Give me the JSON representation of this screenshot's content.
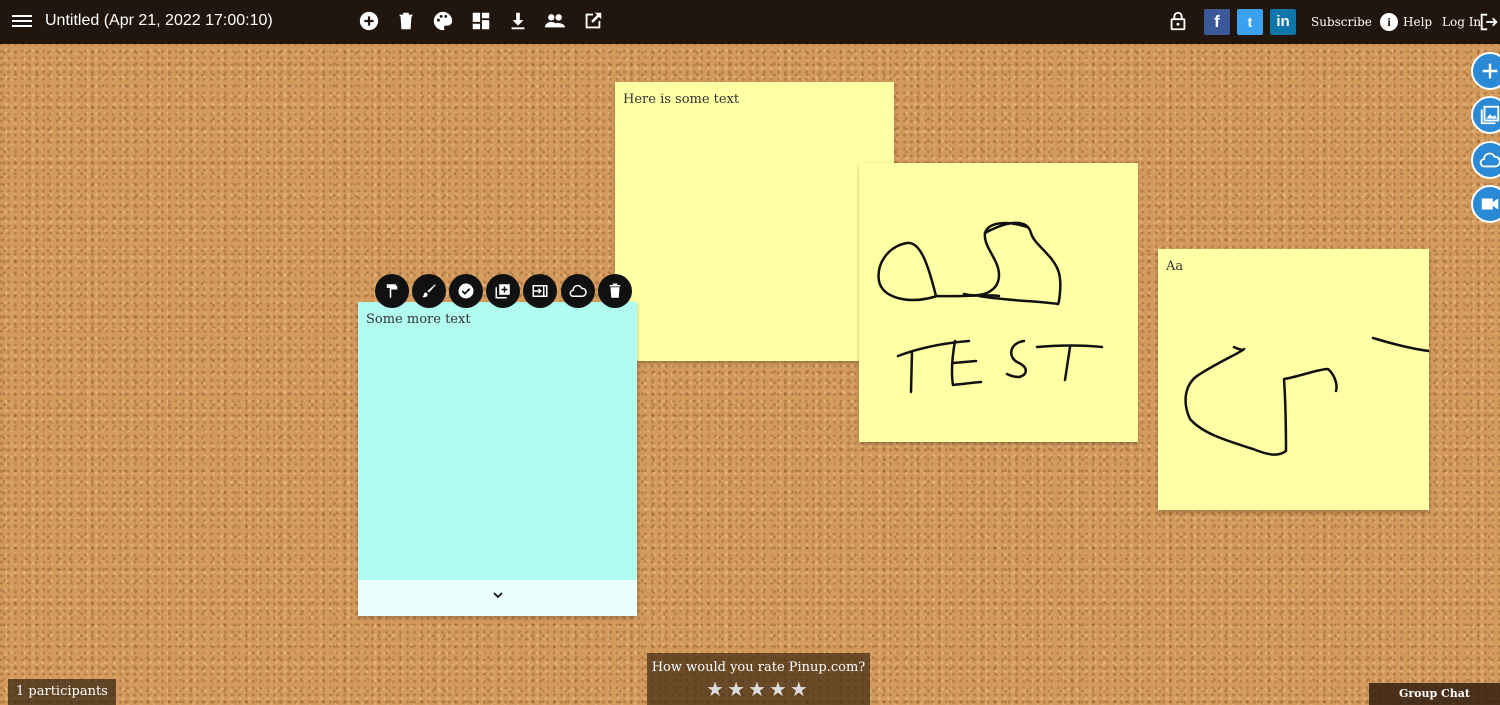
{
  "header": {
    "title": "Untitled (Apr 21, 2022 17:00:10)",
    "toolbar_icons": [
      "add-circle-icon",
      "trash-icon",
      "palette-icon",
      "layout-icon",
      "download-icon",
      "people-icon",
      "external-edit-icon"
    ],
    "lock_icon": "lock-icon",
    "social": {
      "facebook": "f",
      "twitter": "t",
      "linkedin": "in"
    },
    "subscribe": "Subscribe",
    "help_symbol": "i",
    "help": "Help",
    "login": "Log In"
  },
  "side_buttons": [
    "plus-icon",
    "image-icon",
    "cloud-icon",
    "video-icon"
  ],
  "notes": [
    {
      "text": "Here is some text",
      "color": "#ffffa6"
    },
    {
      "text": "",
      "color": "#ffffa6",
      "drawing": "TEST"
    },
    {
      "text": "Aa",
      "color": "#ffffa6"
    },
    {
      "text": "Some more text",
      "color": "#b1fbf1"
    }
  ],
  "note_toolbar": [
    "format-paint-icon",
    "brush-icon",
    "check-icon",
    "duplicate-icon",
    "move-to-icon",
    "cloud-icon",
    "delete-icon"
  ],
  "footer": {
    "participants": "1 participants",
    "rating_question": "How would you rate Pinup.com?",
    "stars": "★★★★★",
    "group_chat": "Group Chat"
  },
  "colors": {
    "topbar": "#20160d",
    "accent": "#2a8ad6",
    "cork": "#d39a5c"
  }
}
